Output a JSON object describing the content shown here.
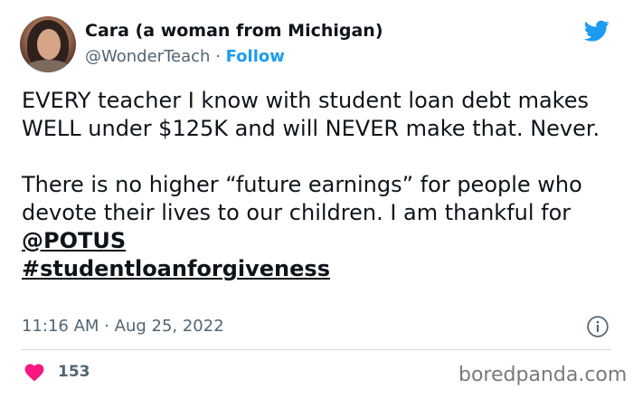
{
  "author": {
    "display_name": "Cara (a woman from Michigan)",
    "handle": "@WonderTeach",
    "separator": " · ",
    "follow_label": "Follow"
  },
  "tweet": {
    "para1": "EVERY teacher I know with student loan debt makes WELL under $125K and will NEVER make that. Never.",
    "para2_text": "There is no higher “future earnings” for people who devote their lives to our children. I am thankful for ",
    "mention": "@POTUS",
    "hashtag": "#studentloanforgiveness"
  },
  "meta": {
    "time": "11:16 AM",
    "separator": " · ",
    "date": "Aug 25, 2022"
  },
  "engagement": {
    "like_count": "153"
  },
  "watermark": "boredpanda.com",
  "icons": {
    "platform": "twitter-bird-icon",
    "like": "heart-icon",
    "info": "info-icon"
  },
  "colors": {
    "accent": "#1d9bf0",
    "like": "#f91880",
    "muted": "#536471"
  }
}
